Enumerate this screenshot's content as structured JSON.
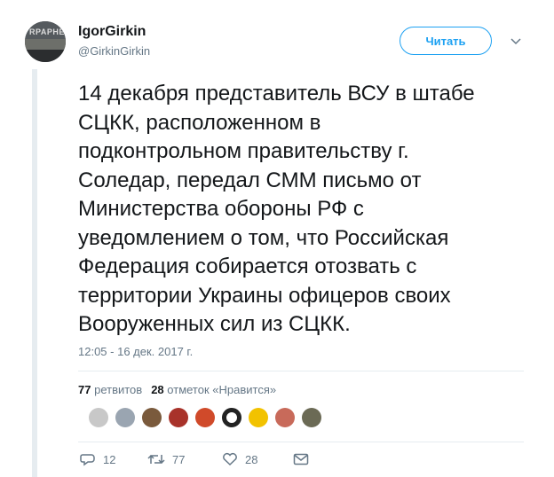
{
  "author": {
    "display_name": "IgorGirkin",
    "handle": "@GirkinGirkin",
    "avatar_text": "RPAPHE"
  },
  "follow_label": "Читать",
  "tweet": {
    "text": "14 декабря представитель ВСУ в штабе\nСЦКК, расположенном в\nподконтрольном правительству г.\nСоледар, передал СММ письмо от\nМинистерства обороны РФ с\nуведомлением о том, что Российская\nФедерация собирается отозвать с\nтерритории Украины офицеров своих\nВооруженных сил из СЦКК.",
    "timestamp": "12:05 - 16 дек. 2017 г."
  },
  "stats": {
    "retweets_count": "77",
    "retweets_label": "ретвитов",
    "likes_count": "28",
    "likes_label": "отметок «Нравится»"
  },
  "likers": [
    {
      "name": "liker-avatar-1",
      "color": "#c8c8c8"
    },
    {
      "name": "liker-avatar-2",
      "color": "#9aa5b1"
    },
    {
      "name": "liker-avatar-3",
      "color": "#7a5a3c"
    },
    {
      "name": "liker-avatar-4",
      "color": "#a8322a"
    },
    {
      "name": "liker-avatar-5",
      "color": "#d04a2a"
    },
    {
      "name": "liker-avatar-6",
      "color": "#222222"
    },
    {
      "name": "liker-avatar-7",
      "color": "#f2c200"
    },
    {
      "name": "liker-avatar-8",
      "color": "#c86a5a"
    },
    {
      "name": "liker-avatar-9",
      "color": "#6b6a55"
    }
  ],
  "actions": {
    "reply_count": "12",
    "retweet_count": "77",
    "like_count": "28"
  },
  "icons": {
    "caret": "chevron-down-icon",
    "reply": "reply-icon",
    "retweet": "retweet-icon",
    "like": "heart-icon",
    "message": "envelope-icon"
  },
  "colors": {
    "accent": "#1da1f2",
    "muted": "#657786",
    "text": "#14171a",
    "border": "#e6ecf0"
  }
}
